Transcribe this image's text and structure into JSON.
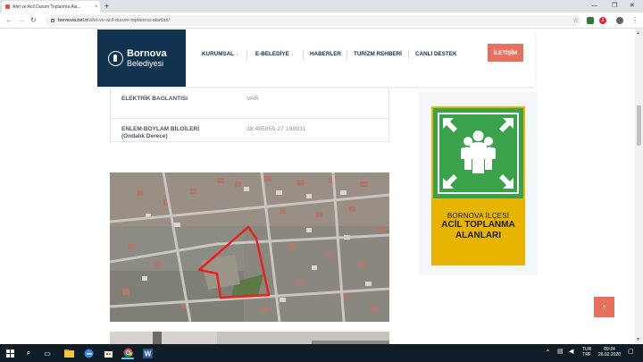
{
  "browser": {
    "tab_title": "Afet ve Acil Durum Toplanma Ala...",
    "tab_close": "×",
    "new_tab": "+",
    "url_host": "bornova.bel.tr",
    "url_path": "/afet-ve-acil-durum-toplanma-alanlari/",
    "ext_badge": "2"
  },
  "site": {
    "logo_line1": "Bornova",
    "logo_line2": "Belediyesi",
    "menu": [
      {
        "label": "KURUMSAL"
      },
      {
        "label": "E-BELEDİYE"
      },
      {
        "label": "HABERLER"
      },
      {
        "label": "TURİZM REHBERİ"
      },
      {
        "label": "CANLI DESTEK"
      }
    ],
    "dropdown_caret": "↓",
    "contact_label": "İLETİŞİM"
  },
  "info_table": [
    {
      "label": "ELEKTRİK BAGLANTISI",
      "value": "VAR"
    },
    {
      "label_line1": "ENLEM-BOYLAM BİLGİLERİ",
      "label_line2": "(Ondalık Derece)",
      "value": "38.485855-27.198931"
    }
  ],
  "poster": {
    "line1": "BORNOVA İLÇESİ",
    "line2": "ACİL TOPLANMA",
    "line3": "ALANLARI",
    "accent_green": "#3aa24b",
    "accent_yellow": "#e7b500"
  },
  "back_to_top": "↑",
  "taskbar": {
    "lang_top": "TUR",
    "lang_bottom": "TRF",
    "time": "09:24",
    "date": "26.02.2020"
  },
  "colors": {
    "brand_navy": "#12334f",
    "accent_coral": "#e8705e"
  }
}
